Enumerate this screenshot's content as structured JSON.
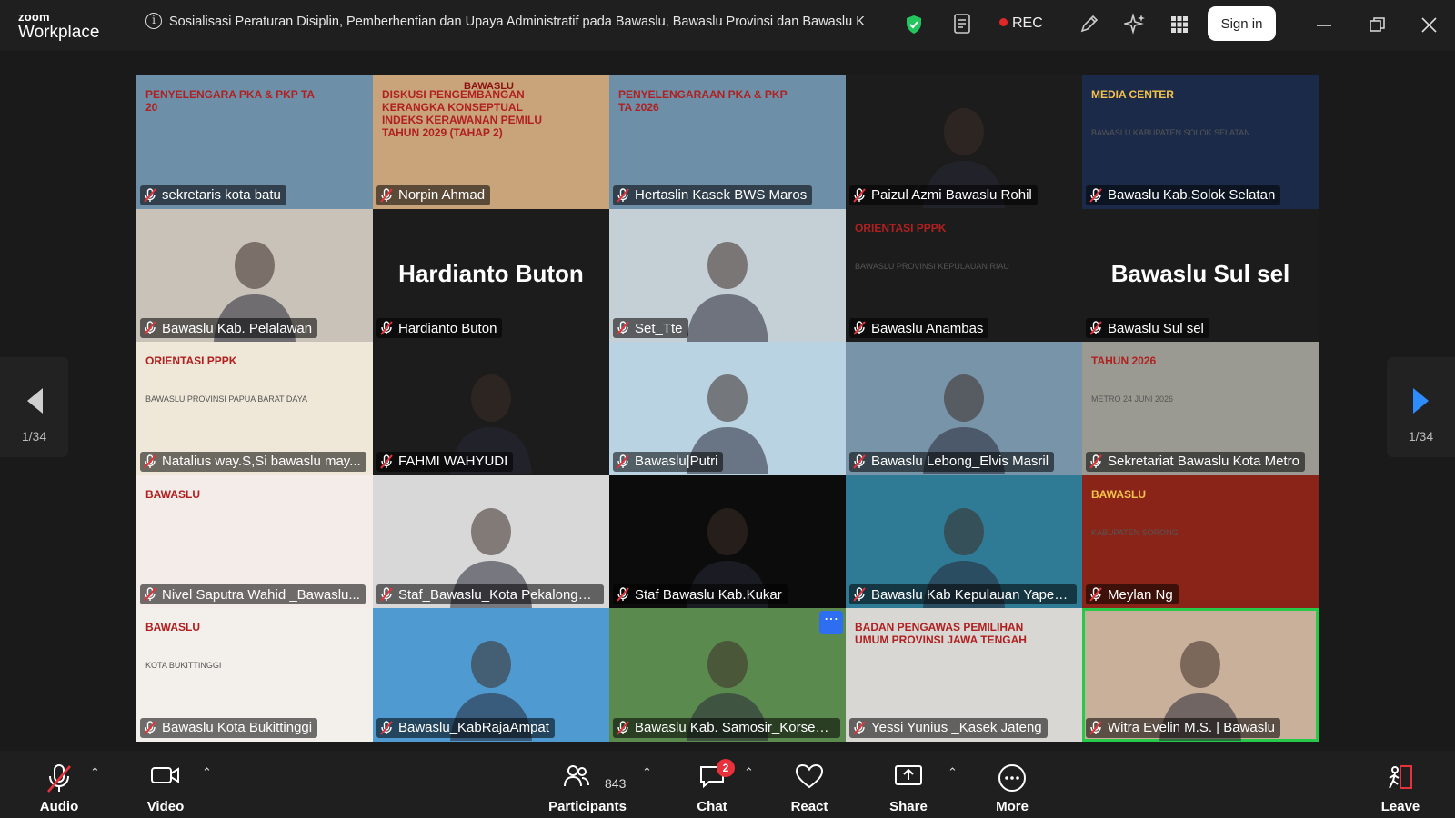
{
  "app": {
    "brand_top": "zoom",
    "brand_bottom": "Workplace"
  },
  "meeting": {
    "title": "Sosialisasi Peraturan Disiplin, Pemberhentian dan Upaya Administratif pada Bawaslu, Bawaslu Provinsi dan Bawaslu Kabupaten/Kota",
    "rec_label": "REC",
    "signin_label": "Sign in"
  },
  "pager": {
    "left_label": "1/34",
    "right_label": "1/34"
  },
  "tiles": [
    {
      "name": "sekretaris kota batu",
      "bg": "#6d8fa8",
      "overlay": "PENYELENGARA PKA & PKP TA 20"
    },
    {
      "name": "Norpin Ahmad",
      "bg": "#c9a47a",
      "overlay": "DISKUSI PENGEMBANGAN KERANGKA KONSEPTUAL INDEKS KERAWANAN PEMILU TAHUN 2029 (TAHAP 2)",
      "brand": "BAWASLU"
    },
    {
      "name": "Hertaslin Kasek BWS Maros",
      "bg": "#6d8fa8",
      "overlay": "PENYELENGARAAN PKA & PKP TA 2026"
    },
    {
      "name": "Paizul Azmi Bawaslu Rohil",
      "bg": "#1c1c1c"
    },
    {
      "name": "Bawaslu Kab.Solok Selatan",
      "bg": "#1c2a4a",
      "overlay": "MEDIA CENTER",
      "sub": "BAWASLU KABUPATEN SOLOK SELATAN"
    },
    {
      "name": "Bawaslu Kab. Pelalawan",
      "bg": "#c8c2b8"
    },
    {
      "name": "Hardianto Buton",
      "bg": "#1c1c1c",
      "big": "Hardianto Buton"
    },
    {
      "name": "Set_Tte",
      "bg": "#c5cfd6"
    },
    {
      "name": "Bawaslu Anambas",
      "bg": "#1c1c1c",
      "overlay": "ORIENTASI PPPK",
      "sub": "BAWASLU PROVINSI KEPULAUAN RIAU"
    },
    {
      "name": "Bawaslu Sul sel",
      "bg": "#1c1c1c",
      "big": "Bawaslu Sul sel"
    },
    {
      "name": "Natalius way.S,Si bawaslu may...",
      "bg": "#efe8d8",
      "overlay": "ORIENTASI PPPK",
      "sub": "BAWASLU PROVINSI PAPUA BARAT DAYA"
    },
    {
      "name": "FAHMI WAHYUDI",
      "bg": "#1c1c1c"
    },
    {
      "name": "Bawaslu|Putri",
      "bg": "#b9d3e3"
    },
    {
      "name": "Bawaslu Lebong_Elvis Masril",
      "bg": "#7894a8"
    },
    {
      "name": "Sekretariat Bawaslu Kota Metro",
      "bg": "#9a9a92",
      "overlay": "TAHUN 2026",
      "sub": "METRO 24 JUNI 2026"
    },
    {
      "name": "Nivel Saputra Wahid _Bawaslu...",
      "bg": "#f4ece8",
      "overlay": "BAWASLU"
    },
    {
      "name": "Staf_Bawaslu_Kota Pekalongan ...",
      "bg": "#d8d8d8"
    },
    {
      "name": "Staf Bawaslu Kab.Kukar",
      "bg": "#0c0c0c"
    },
    {
      "name": "Bawaslu Kab Kepulauan Yapen...",
      "bg": "#2f7b95"
    },
    {
      "name": "Meylan Ng",
      "bg": "#8a2418",
      "overlay": "BAWASLU",
      "sub": "KABUPATEN SORONG"
    },
    {
      "name": "Bawaslu Kota Bukittinggi",
      "bg": "#f3efea",
      "overlay": "BAWASLU",
      "sub": "KOTA BUKITTINGGI"
    },
    {
      "name": "Bawaslu_KabRajaAmpat",
      "bg": "#4f9ad0"
    },
    {
      "name": "Bawaslu Kab. Samosir_Korsek_...",
      "bg": "#5b8a4e"
    },
    {
      "name": "Yessi Yunius _Kasek Jateng",
      "bg": "#d9d7d3",
      "overlay": "BADAN PENGAWAS PEMILIHAN UMUM PROVINSI JAWA TENGAH"
    },
    {
      "name": "Witra Evelin M.S. | Bawaslu",
      "bg": "#c9b09a",
      "active": true
    }
  ],
  "toolbar": {
    "audio": "Audio",
    "video": "Video",
    "participants": "Participants",
    "participants_count": "843",
    "chat": "Chat",
    "chat_badge": "2",
    "react": "React",
    "share": "Share",
    "more": "More",
    "leave": "Leave"
  }
}
